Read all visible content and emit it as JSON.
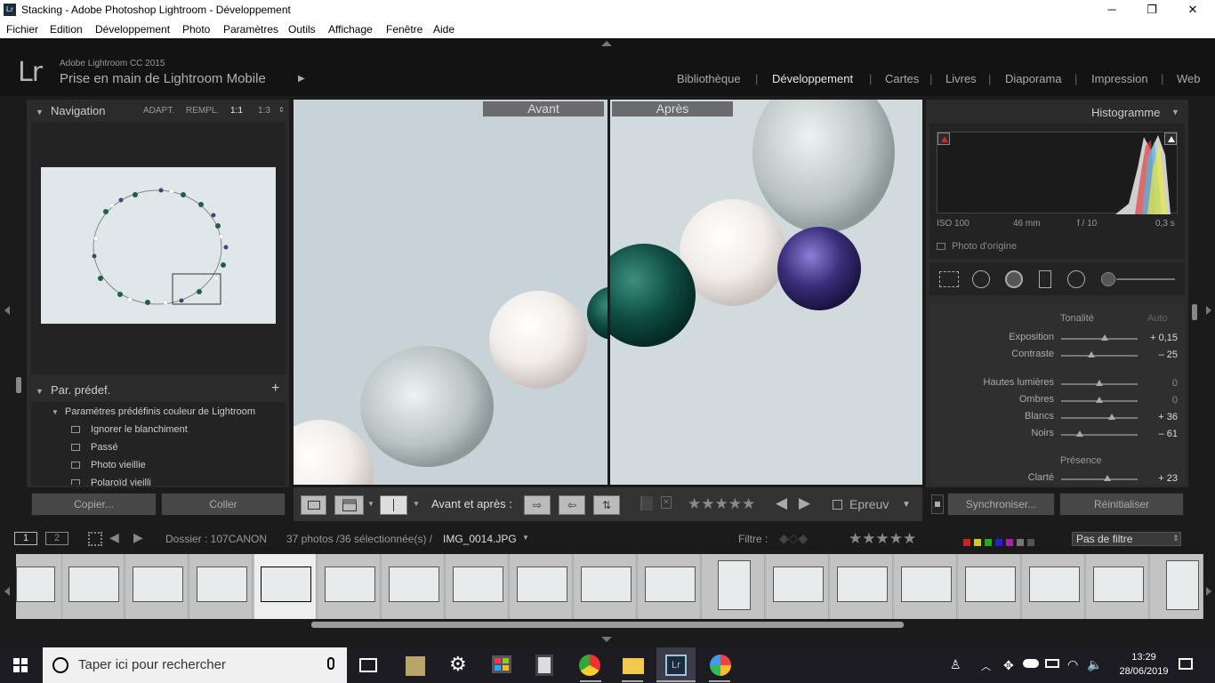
{
  "window": {
    "title": "Stacking - Adobe Photoshop Lightroom - Développement",
    "minimize": "─",
    "maximize": "❐",
    "close": "✕"
  },
  "menu": [
    "Fichier",
    "Edition",
    "Développement",
    "Photo",
    "Paramètres",
    "Outils",
    "Affichage",
    "Fenêtre",
    "Aide"
  ],
  "identity": {
    "version": "Adobe Lightroom CC 2015",
    "catalog": "Prise en main de Lightroom Mobile",
    "arrow": "▶",
    "logo": "Lr"
  },
  "modules": [
    {
      "label": "Bibliothèque",
      "active": false
    },
    {
      "label": "Développement",
      "active": true
    },
    {
      "label": "Cartes",
      "active": false
    },
    {
      "label": "Livres",
      "active": false
    },
    {
      "label": "Diaporama",
      "active": false
    },
    {
      "label": "Impression",
      "active": false
    },
    {
      "label": "Web",
      "active": false
    }
  ],
  "navigator": {
    "title": "Navigation",
    "fit": "ADAPT.",
    "fill": "REMPL.",
    "one": "1:1",
    "ratio": "1:3"
  },
  "presets": {
    "title": "Par. prédef.",
    "add": "+",
    "group": "Paramètres prédéfinis couleur de Lightroom",
    "items": [
      "Ignorer le blanchiment",
      "Passé",
      "Photo vieillie",
      "Polaroïd vieilli"
    ]
  },
  "left_buttons": {
    "copy": "Copier...",
    "paste": "Coller"
  },
  "compare": {
    "before": "Avant",
    "after": "Après"
  },
  "histogram": {
    "title": "Histogramme",
    "iso": "ISO 100",
    "focal": "46 mm",
    "aperture": "f / 10",
    "shutter": "0,3 s",
    "original": "Photo d'origine"
  },
  "basic": {
    "tone_title": "Tonalité",
    "auto": "Auto",
    "sliders": [
      {
        "label": "Exposition",
        "value": "+ 0,15",
        "pos": 0.57
      },
      {
        "label": "Contraste",
        "value": "– 25",
        "pos": 0.4
      },
      {
        "label": "Hautes lumières",
        "value": "0",
        "pos": 0.5
      },
      {
        "label": "Ombres",
        "value": "0",
        "pos": 0.5
      },
      {
        "label": "Blancs",
        "value": "+ 36",
        "pos": 0.66
      },
      {
        "label": "Noirs",
        "value": "– 61",
        "pos": 0.24
      }
    ],
    "presence_title": "Présence",
    "clarity": {
      "label": "Clarté",
      "value": "+ 23",
      "pos": 0.6
    }
  },
  "right_buttons": {
    "sync": "Synchroniser...",
    "reset": "Réinitialiser"
  },
  "toolbar": {
    "before_after_label": "Avant et après :",
    "proof": "Epreuv",
    "stars": "★★★★★"
  },
  "filmstrip_bar": {
    "screen1": "1",
    "screen2": "2",
    "folder": "Dossier : 107CANON",
    "count": "37 photos /36 sélectionnée(s) /",
    "filename": "IMG_0014.JPG",
    "filter_label": "Filtre :",
    "filter_value": "Pas de filtre",
    "rating": "★★★★★"
  },
  "taskbar": {
    "search_placeholder": "Taper ici pour rechercher",
    "time": "13:29",
    "date": "28/06/2019"
  },
  "colors": {
    "accent": "#e6e6e6",
    "panel": "#2b2b2b",
    "background": "#1b1b1b"
  }
}
